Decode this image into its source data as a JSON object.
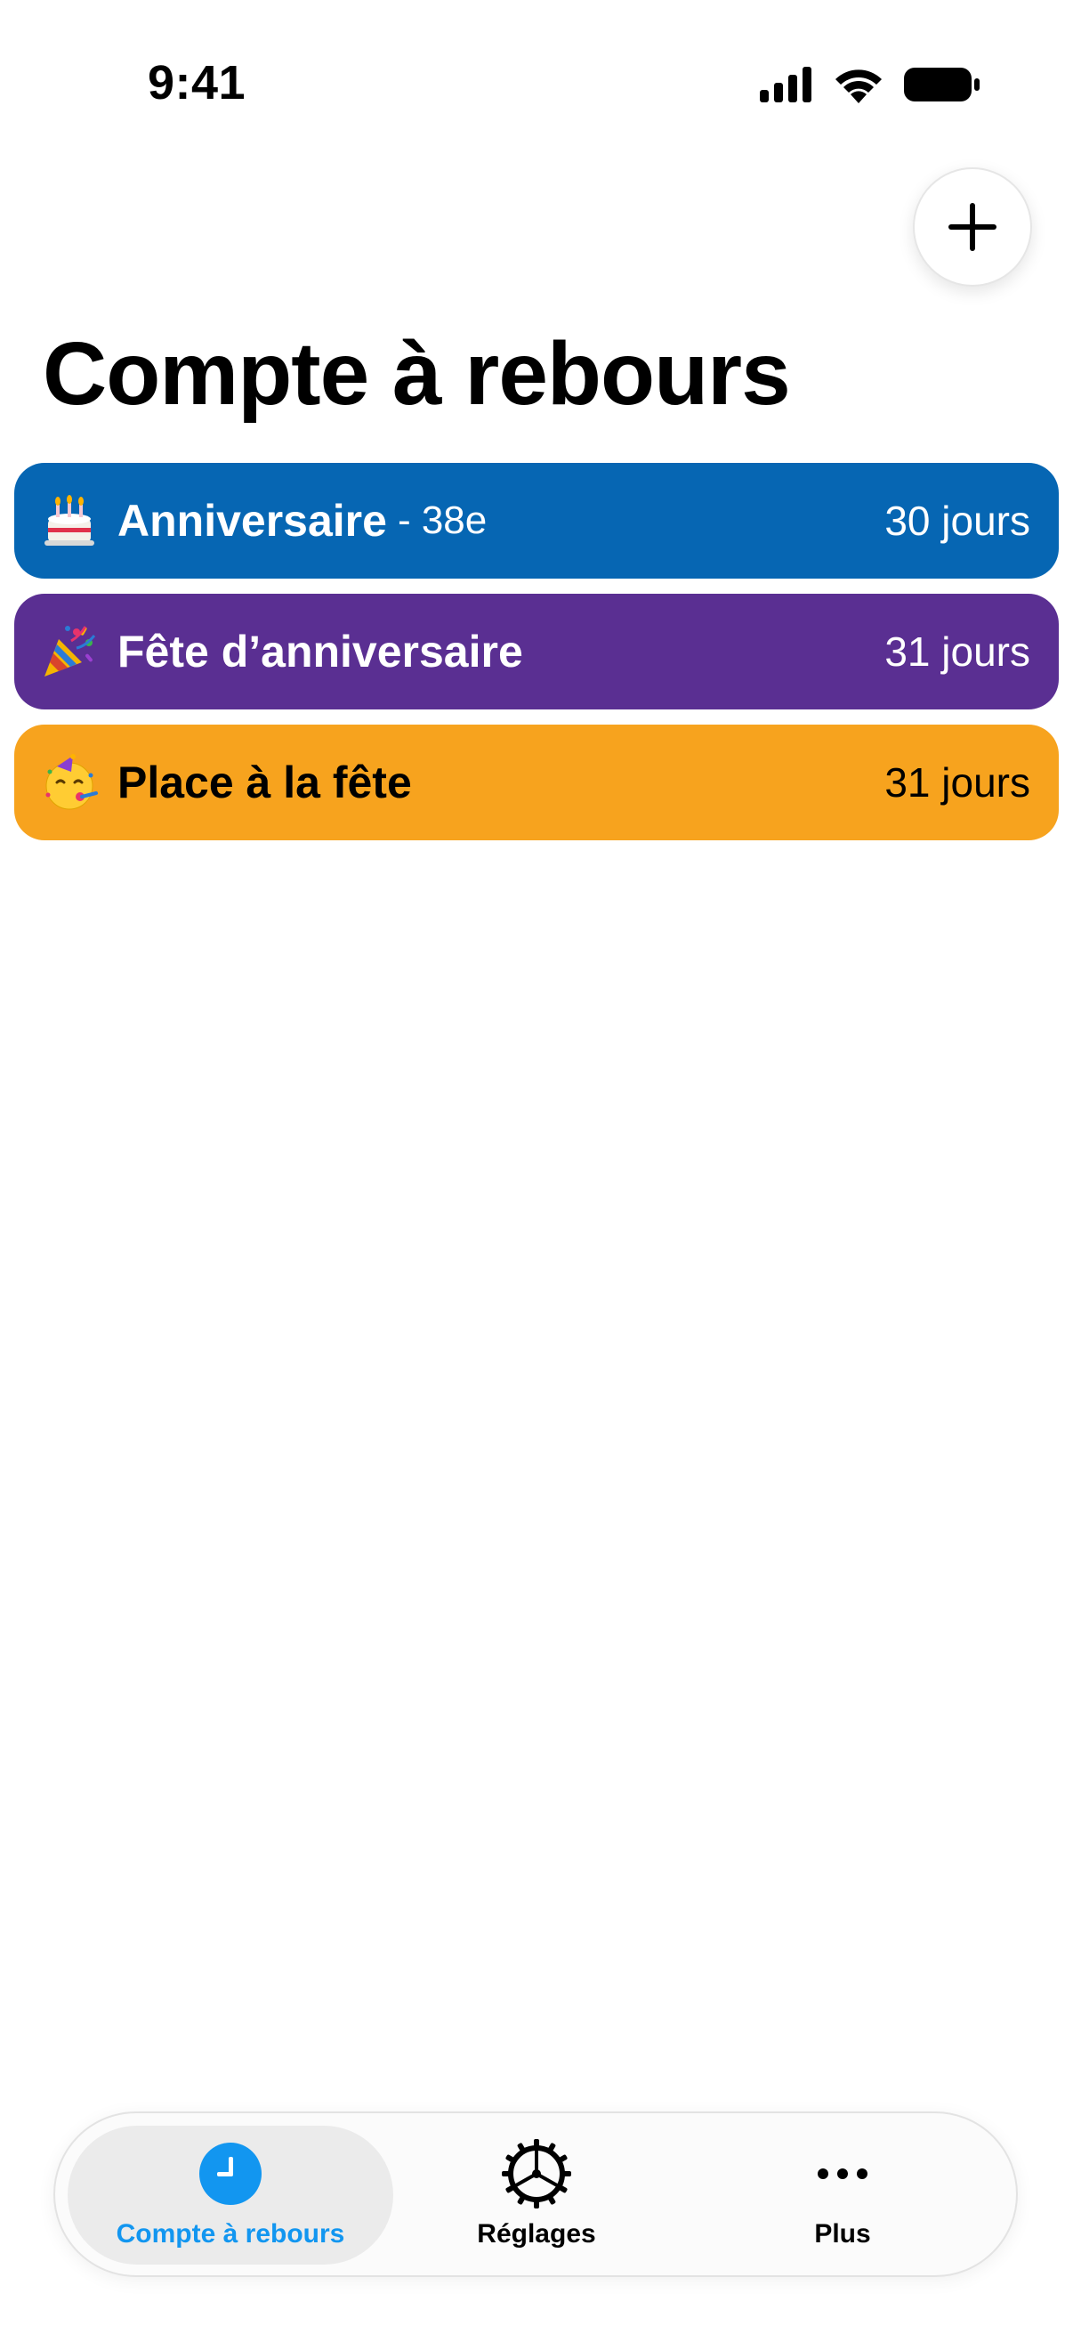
{
  "status_bar": {
    "time": "9:41"
  },
  "header": {
    "add_icon": "plus-icon",
    "title": "Compte à rebours"
  },
  "countdowns": [
    {
      "emoji": "birthday-cake-emoji",
      "title": "Anniversaire",
      "subtitle": "- 38e",
      "days": "30 jours",
      "color": "#0666b3",
      "text_color": "#ffffff"
    },
    {
      "emoji": "party-popper-emoji",
      "title": "Fête d’anniversaire",
      "subtitle": "",
      "days": "31 jours",
      "color": "#5a2f92",
      "text_color": "#ffffff"
    },
    {
      "emoji": "partying-face-emoji",
      "title": "Place à la fête",
      "subtitle": "",
      "days": "31 jours",
      "color": "#f7a31e",
      "text_color": "#000000"
    }
  ],
  "tab_bar": {
    "tabs": [
      {
        "label": "Compte à rebours",
        "icon": "clock-icon",
        "active": true
      },
      {
        "label": "Réglages",
        "icon": "gear-icon",
        "active": false
      },
      {
        "label": "Plus",
        "icon": "more-icon",
        "active": false
      }
    ]
  },
  "colors": {
    "accent": "#1296f0",
    "background": "#ffffff"
  }
}
